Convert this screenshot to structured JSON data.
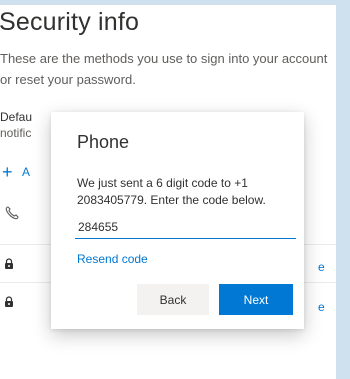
{
  "page": {
    "title": "Security info",
    "intro": "These are the methods you use to sign into your account or reset your password.",
    "default_label": "Defau",
    "default_sub": "notific",
    "add_method_label": "A",
    "row_link_1": "e",
    "row_link_2": "e"
  },
  "dialog": {
    "title": "Phone",
    "message": "We just sent a 6 digit code to +1 2083405779. Enter the code below.",
    "code_value": "284655",
    "resend_link": "Resend code",
    "back_label": "Back",
    "next_label": "Next"
  },
  "icons": {
    "add": "plus-icon",
    "phone": "phone-icon",
    "lock": "lock-icon"
  },
  "colors": {
    "accent": "#0078d4",
    "frame": "#cfe1ef"
  }
}
